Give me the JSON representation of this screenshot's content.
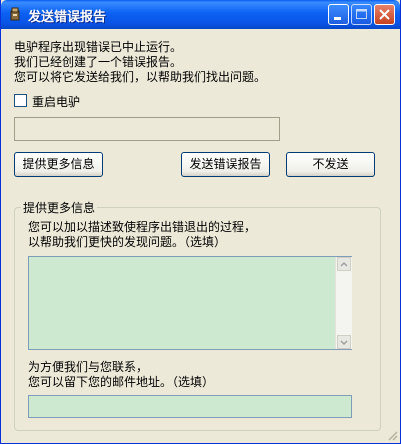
{
  "window": {
    "title": "发送错误报告"
  },
  "message": {
    "line1": "电驴程序出现错误已中止运行。",
    "line2": "我们已经创建了一个错误报告。",
    "line3": "您可以将它发送给我们，以帮助我们找出问题。"
  },
  "restart": {
    "label": "重启电驴",
    "checked": false
  },
  "buttons": {
    "more_info": "提供更多信息",
    "send": "发送错误报告",
    "dont_send": "不发送"
  },
  "details": {
    "group_label": "提供更多信息",
    "desc_line1": "您可以加以描述致使程序出错退出的过程，",
    "desc_line2": "以帮助我们更快的发现问题。（选填）",
    "description_value": "",
    "contact_line1": "为方便我们与您联系，",
    "contact_line2": "您可以留下您的邮件地址。（选填）",
    "email_value": ""
  },
  "colors": {
    "titlebar": "#0a54e6",
    "field_bg": "#cde9d0",
    "dialog_bg": "#ece9d8"
  }
}
